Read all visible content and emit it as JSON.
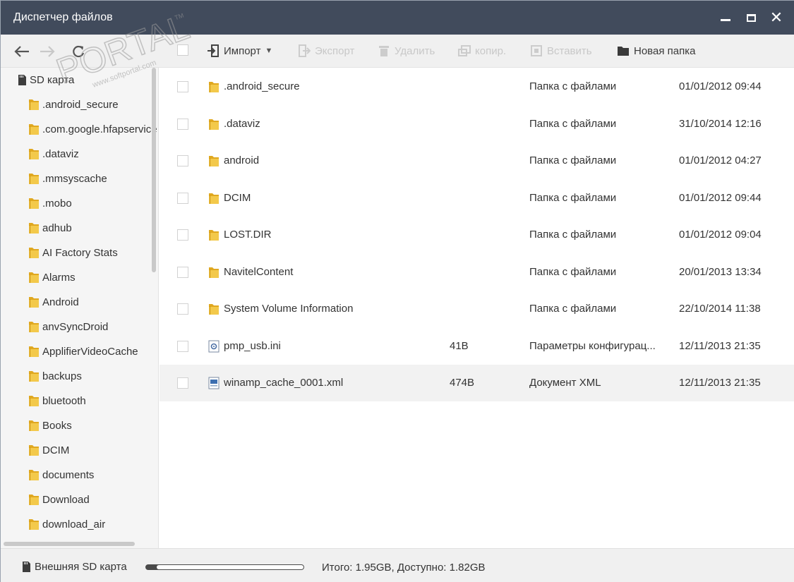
{
  "window": {
    "title": "Диспетчер файлов",
    "minimize_icon": "minimize-icon",
    "maximize_icon": "maximize-icon",
    "close_icon": "close-icon"
  },
  "toolbar": {
    "back_icon": "arrow-left-icon",
    "forward_icon": "arrow-right-icon",
    "refresh_icon": "refresh-icon",
    "import_label": "Импорт",
    "export_label": "Экспорт",
    "delete_label": "Удалить",
    "copy_label": "копир.",
    "paste_label": "Вставить",
    "new_folder_label": "Новая папка"
  },
  "watermark": {
    "text": "PORTAL",
    "url": "www.softportal.com",
    "tm": "TM"
  },
  "sidebar": {
    "root_label": "SD карта",
    "items": [
      ".android_secure",
      ".com.google.hfapservice",
      ".dataviz",
      ".mmsyscache",
      ".mobo",
      "adhub",
      "AI Factory Stats",
      "Alarms",
      "Android",
      "anvSyncDroid",
      "ApplifierVideoCache",
      "backups",
      "bluetooth",
      "Books",
      "DCIM",
      "documents",
      "Download",
      "download_air"
    ]
  },
  "files": [
    {
      "name": ".android_secure",
      "size": "",
      "type": "Папка с файлами",
      "date": "01/01/2012 09:44",
      "icon": "folder-icon"
    },
    {
      "name": ".dataviz",
      "size": "",
      "type": "Папка с файлами",
      "date": "31/10/2014 12:16",
      "icon": "folder-icon"
    },
    {
      "name": "android",
      "size": "",
      "type": "Папка с файлами",
      "date": "01/01/2012 04:27",
      "icon": "folder-icon"
    },
    {
      "name": "DCIM",
      "size": "",
      "type": "Папка с файлами",
      "date": "01/01/2012 09:44",
      "icon": "folder-icon"
    },
    {
      "name": "LOST.DIR",
      "size": "",
      "type": "Папка с файлами",
      "date": "01/01/2012 09:04",
      "icon": "folder-icon"
    },
    {
      "name": "NavitelContent",
      "size": "",
      "type": "Папка с файлами",
      "date": "20/01/2013 13:34",
      "icon": "folder-icon"
    },
    {
      "name": "System Volume Information",
      "size": "",
      "type": "Папка с файлами",
      "date": "22/10/2014 11:38",
      "icon": "folder-icon"
    },
    {
      "name": "pmp_usb.ini",
      "size": "41B",
      "type": "Параметры конфигурац...",
      "date": "12/11/2013 21:35",
      "icon": "config-file-icon"
    },
    {
      "name": "winamp_cache_0001.xml",
      "size": "474B",
      "type": "Документ XML",
      "date": "12/11/2013 21:35",
      "icon": "xml-file-icon"
    }
  ],
  "statusbar": {
    "sd_label": "Внешняя SD карта",
    "storage_text": "Итого: 1.95GB, Доступно: 1.82GB",
    "used_fraction": 0.067
  },
  "colors": {
    "titlebar": "#414b5c",
    "folder": "#e8b830",
    "toolbar": "#f0f0f0"
  }
}
